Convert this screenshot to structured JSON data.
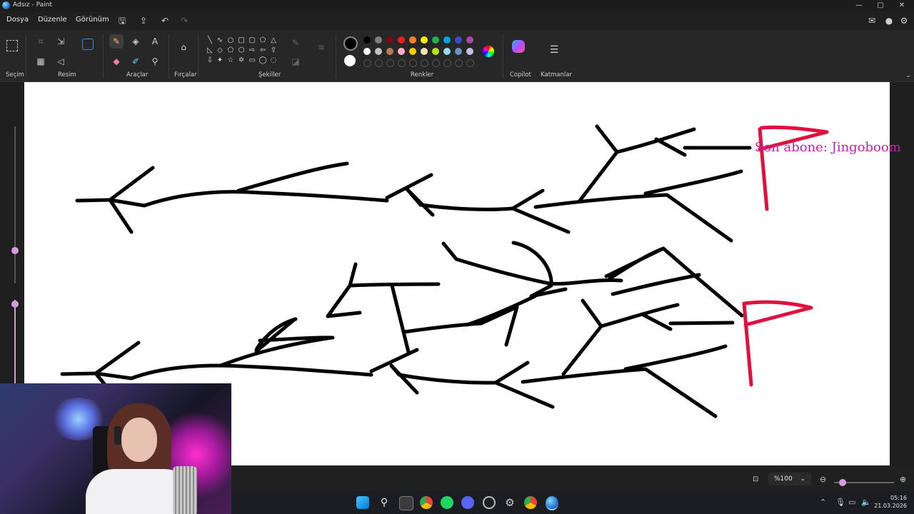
{
  "window": {
    "title": "Adsız - Paint",
    "controls": [
      "—",
      "▢",
      "✕"
    ]
  },
  "menu": {
    "items": [
      "Dosya",
      "Düzenle",
      "Görünüm"
    ]
  },
  "ribbon": {
    "groups": {
      "selection": "Seçim",
      "image": "Resim",
      "tools": "Araçlar",
      "brushes": "Fırçalar",
      "shapes": "Şekiller",
      "colors": "Renkler",
      "copilot": "Copilot",
      "layers": "Katmanlar"
    },
    "active_tool": "pencil",
    "primary_color": "#000000",
    "secondary_color": "#ffffff",
    "palette_row1": [
      "#000000",
      "#7f7f7f",
      "#880015",
      "#ed1c24",
      "#ff7f27",
      "#fff200",
      "#22b14c",
      "#00a2e8",
      "#3f48cc",
      "#a349a4"
    ],
    "palette_row2": [
      "#ffffff",
      "#c3c3c3",
      "#b97a57",
      "#ffaec9",
      "#ffc90e",
      "#efe4b0",
      "#b5e61d",
      "#99d9ea",
      "#7092be",
      "#c8bfe7"
    ]
  },
  "canvas": {
    "overlay_text": "Son abone: Jingoboom",
    "stroke_color": "#000000",
    "flag_color": "#e0103f"
  },
  "status": {
    "zoom": "%100"
  },
  "taskbar": {
    "time": "05:16",
    "date": "21.03.2026"
  }
}
